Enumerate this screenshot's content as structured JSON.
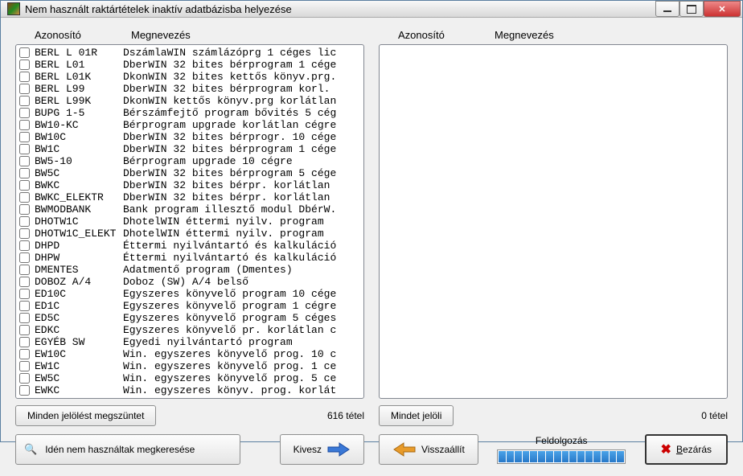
{
  "window": {
    "title": "Nem használt raktártételek inaktív adatbázisba helyezése"
  },
  "headers": {
    "id": "Azonosító",
    "name": "Megnevezés"
  },
  "left": {
    "items": [
      {
        "id": "BERL L 01R",
        "desc": "DszámlaWIN számlázóprg 1 céges lic"
      },
      {
        "id": "BERL L01",
        "desc": "DberWIN 32 bites bérprogram 1 cége"
      },
      {
        "id": "BERL L01K",
        "desc": "DkonWIN 32 bites kettős könyv.prg."
      },
      {
        "id": "BERL L99",
        "desc": "DberWIN 32 bites bérprogram korl."
      },
      {
        "id": "BERL L99K",
        "desc": "DkonWIN kettős könyv.prg korlátlan"
      },
      {
        "id": "BUPG 1-5",
        "desc": "Bérszámfejtő program bővités 5 cég"
      },
      {
        "id": "BW10-KC",
        "desc": "Bérprogram upgrade korlátlan cégre"
      },
      {
        "id": "BW10C",
        "desc": "DberWIN 32 bites bérprogr. 10 cége"
      },
      {
        "id": "BW1C",
        "desc": "DberWIN 32 bites bérprogram 1 cége"
      },
      {
        "id": "BW5-10",
        "desc": "Bérprogram upgrade 10 cégre"
      },
      {
        "id": "BW5C",
        "desc": "DberWIN 32 bites bérprogram 5 cége"
      },
      {
        "id": "BWKC",
        "desc": "DberWIN 32 bites bérpr. korlátlan"
      },
      {
        "id": "BWKC_ELEKTR",
        "desc": "DberWIN 32 bites bérpr. korlátlan"
      },
      {
        "id": "BWMODBANK",
        "desc": "Bank program illesztő modul DbérW."
      },
      {
        "id": "DHOTW1C",
        "desc": "DhotelWIN éttermi nyilv. program"
      },
      {
        "id": "DHOTW1C_ELEKT",
        "desc": "DhotelWIN éttermi nyilv. program"
      },
      {
        "id": "DHPD",
        "desc": "Éttermi nyilvántartó és kalkuláció"
      },
      {
        "id": "DHPW",
        "desc": "Éttermi nyilvántartó és kalkuláció"
      },
      {
        "id": "DMENTES",
        "desc": "Adatmentő program (Dmentes)"
      },
      {
        "id": "DOBOZ A/4",
        "desc": "Doboz (SW) A/4 belső"
      },
      {
        "id": "ED10C",
        "desc": "Egyszeres könyvelő program 10 cége"
      },
      {
        "id": "ED1C",
        "desc": "Egyszeres könyvelő program 1 cégre"
      },
      {
        "id": "ED5C",
        "desc": "Egyszeres könyvelő program 5 céges"
      },
      {
        "id": "EDKC",
        "desc": "Egyszeres könyvelő pr. korlátlan c"
      },
      {
        "id": "EGYÉB SW",
        "desc": "Egyedi nyilvántartó program"
      },
      {
        "id": "EW10C",
        "desc": "Win. egyszeres könyvelő prog. 10 c"
      },
      {
        "id": "EW1C",
        "desc": "Win. egyszeres könyvelő prog. 1 ce"
      },
      {
        "id": "EW5C",
        "desc": "Win. egyszeres könyvelő prog. 5 ce"
      },
      {
        "id": "EWKC",
        "desc": "Win. egyszeres könyv. prog. korlát"
      }
    ],
    "count": "616 tétel",
    "btn_clear": "Minden jelölést megszüntet"
  },
  "right": {
    "items": [],
    "count": "0 tétel",
    "btn_all": "Mindet jelöli"
  },
  "buttons": {
    "search": "Idén nem használtak megkeresése",
    "remove": "Kivesz",
    "restore": "Visszaállít",
    "close": "Bezárás"
  },
  "progress": {
    "label": "Feldolgozás"
  }
}
